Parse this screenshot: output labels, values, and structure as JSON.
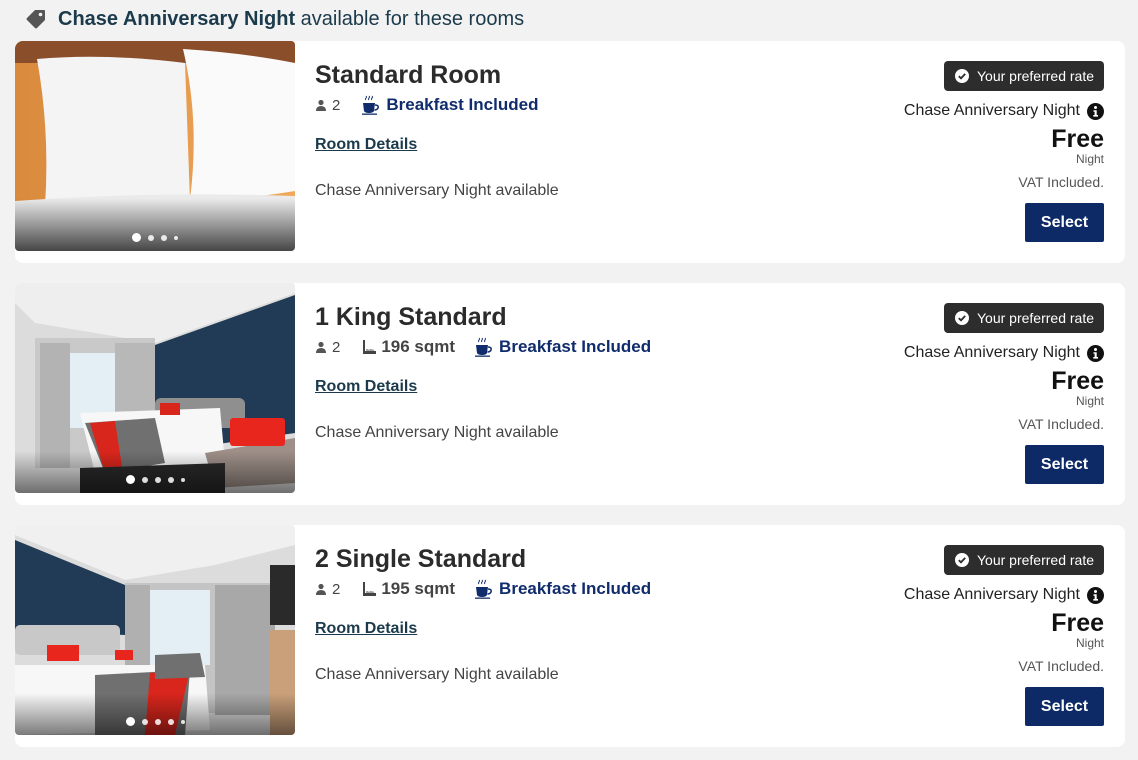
{
  "banner": {
    "icon": "tag-icon",
    "highlight": "Chase Anniversary Night",
    "text": " available for these rooms"
  },
  "colors": {
    "brand_navy": "#0d2a66",
    "breakfast_blue": "#102c6c",
    "badge_dark": "#2d2d2d",
    "link_teal": "#1b3a4b",
    "page_bg": "#f2f2f2"
  },
  "rooms": [
    {
      "title": "Standard Room",
      "occupancy": "2",
      "size": "",
      "breakfast": "Breakfast Included",
      "details_link": "Room Details",
      "availability": "Chase Anniversary Night available",
      "photo": "pillows-on-bed",
      "photo_count": 4,
      "photo_active": 1,
      "badge": "Your preferred rate",
      "rate_name": "Chase Anniversary Night",
      "price": "Free",
      "per": "Night",
      "vat": "VAT Included.",
      "select_label": "Select"
    },
    {
      "title": "1 King Standard",
      "occupancy": "2",
      "size": "196 sqmt",
      "breakfast": "Breakfast Included",
      "details_link": "Room Details",
      "availability": "Chase Anniversary Night available",
      "photo": "king-bedroom",
      "photo_count": 5,
      "photo_active": 1,
      "badge": "Your preferred rate",
      "rate_name": "Chase Anniversary Night",
      "price": "Free",
      "per": "Night",
      "vat": "VAT Included.",
      "select_label": "Select"
    },
    {
      "title": "2 Single Standard",
      "occupancy": "2",
      "size": "195 sqmt",
      "breakfast": "Breakfast Included",
      "details_link": "Room Details",
      "availability": "Chase Anniversary Night available",
      "photo": "twin-bedroom",
      "photo_count": 5,
      "photo_active": 1,
      "badge": "Your preferred rate",
      "rate_name": "Chase Anniversary Night",
      "price": "Free",
      "per": "Night",
      "vat": "VAT Included.",
      "select_label": "Select"
    }
  ]
}
